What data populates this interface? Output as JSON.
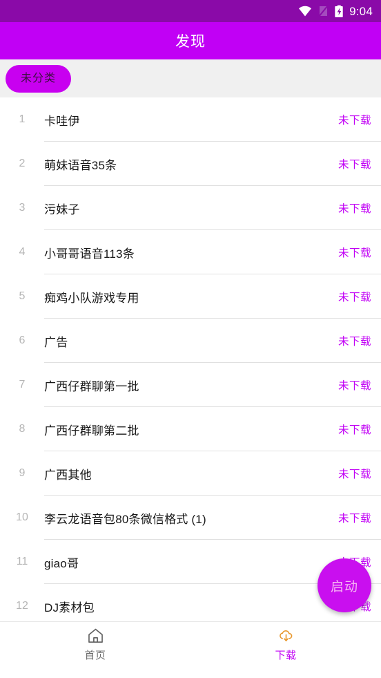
{
  "status_bar": {
    "time": "9:04",
    "background": "#8A0AA8",
    "icons": [
      "wifi-icon",
      "signal-off-icon",
      "battery-charging-icon"
    ]
  },
  "app_bar": {
    "title": "发现",
    "background": "#C100F5",
    "title_color": "#FFFFFF"
  },
  "chip_bar": {
    "background": "#F0F0F0",
    "chips": [
      {
        "label": "未分类",
        "selected": true,
        "color": "#C800F0"
      }
    ]
  },
  "list": {
    "status_color": "#C100F5",
    "rows": [
      {
        "index": "1",
        "title": "卡哇伊",
        "status": "未下载"
      },
      {
        "index": "2",
        "title": "萌妹语音35条",
        "status": "未下载"
      },
      {
        "index": "3",
        "title": "污妹子",
        "status": "未下载"
      },
      {
        "index": "4",
        "title": "小哥哥语音113条",
        "status": "未下载"
      },
      {
        "index": "5",
        "title": "痴鸡小队游戏专用",
        "status": "未下载"
      },
      {
        "index": "6",
        "title": "广告",
        "status": "未下载"
      },
      {
        "index": "7",
        "title": "广西仔群聊第一批",
        "status": "未下载"
      },
      {
        "index": "8",
        "title": "广西仔群聊第二批",
        "status": "未下载"
      },
      {
        "index": "9",
        "title": "广西其他",
        "status": "未下载"
      },
      {
        "index": "10",
        "title": "李云龙语音包80条微信格式 (1)",
        "status": "未下载"
      },
      {
        "index": "11",
        "title": "giao哥",
        "status": "未下载"
      },
      {
        "index": "12",
        "title": "DJ素材包",
        "status": "未下载"
      }
    ]
  },
  "fab": {
    "label": "启动",
    "background": "#C90FEF",
    "label_color": "#F6B9F2"
  },
  "bottom_nav": {
    "items": [
      {
        "label": "首页",
        "icon": "home-icon",
        "active": false,
        "color": "#6E6E6E"
      },
      {
        "label": "下载",
        "icon": "cloud-download-icon",
        "active": true,
        "color": "#C100F5",
        "icon_color": "#E8972B"
      }
    ]
  }
}
